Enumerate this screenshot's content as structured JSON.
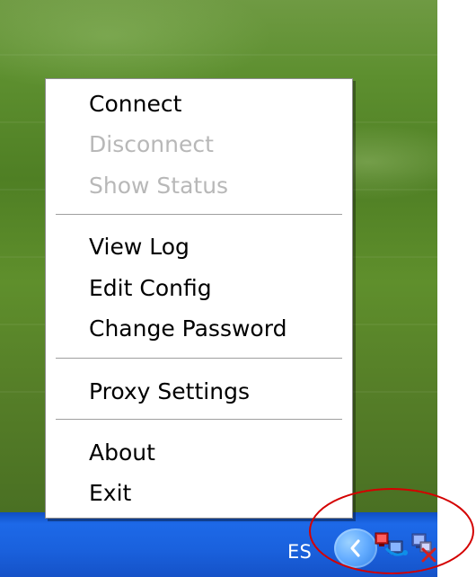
{
  "menu": {
    "items": [
      {
        "label": "Connect"
      },
      {
        "label": "Disconnect"
      },
      {
        "label": "Show Status"
      },
      {
        "label": "View Log"
      },
      {
        "label": "Edit Config"
      },
      {
        "label": "Change Password"
      },
      {
        "label": "Proxy Settings"
      },
      {
        "label": "About"
      },
      {
        "label": "Exit"
      }
    ]
  },
  "taskbar": {
    "language": "ES"
  },
  "icons": {
    "tray_expand": "chevron-left-icon",
    "connected": "network-connection-icon",
    "disconnected": "network-disconnected-icon"
  },
  "colors": {
    "taskbar": "#1a61dd",
    "menu_bg": "#ffffff",
    "disabled_text": "#b8b8b8",
    "annotation": "#d40000"
  }
}
